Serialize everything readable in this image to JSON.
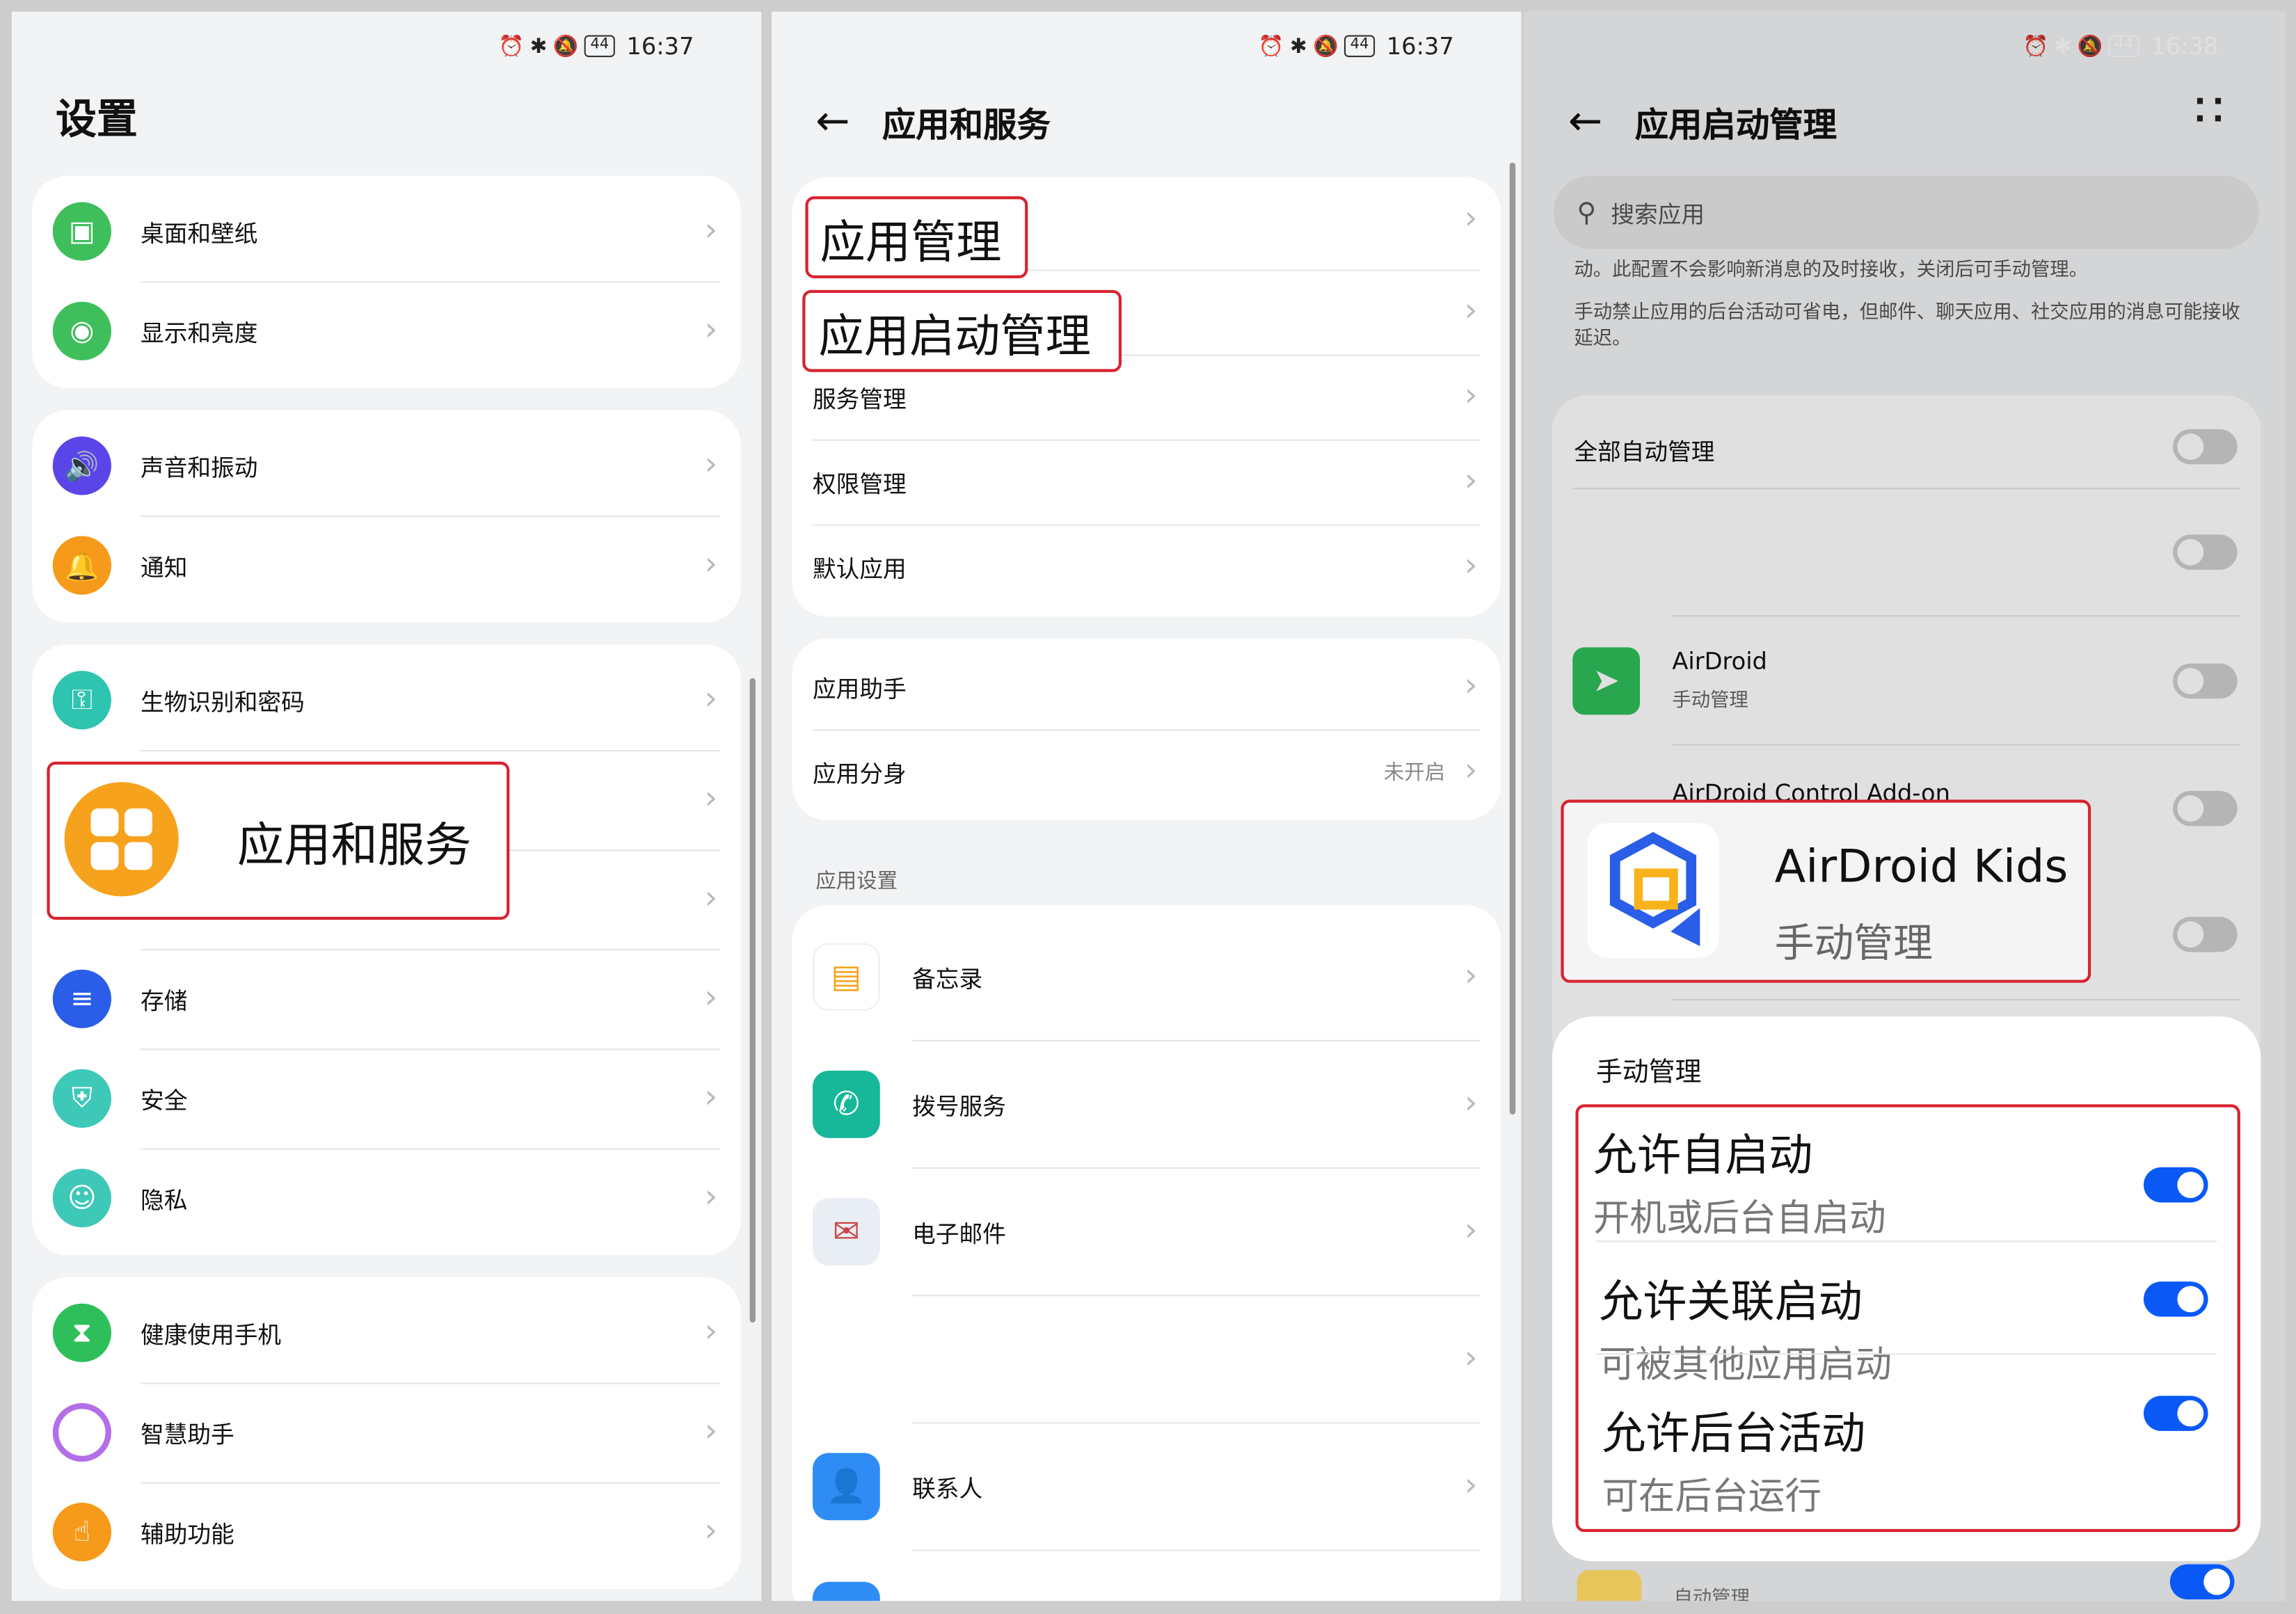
{
  "status_bar": {
    "p1_time": "16:37",
    "p2_time": "16:37",
    "p3_time": "16:38",
    "battery": "44"
  },
  "panel1": {
    "title": "设置",
    "groups": [
      [
        {
          "label": "桌面和壁纸",
          "icon": "picture-icon",
          "color": "#3fbf5c"
        },
        {
          "label": "显示和亮度",
          "icon": "eye-icon",
          "color": "#3fbf5c"
        }
      ],
      [
        {
          "label": "声音和振动",
          "icon": "speaker-icon",
          "color": "#5a46e8"
        },
        {
          "label": "通知",
          "icon": "bell-icon",
          "color": "#f59a1a"
        }
      ],
      [
        {
          "label": "生物识别和密码",
          "icon": "key-icon",
          "color": "#2ec4b0"
        },
        {
          "label": "",
          "icon": "",
          "color": ""
        },
        {
          "label": "",
          "icon": "",
          "color": ""
        },
        {
          "label": "存储",
          "icon": "storage-icon",
          "color": "#2a5de8"
        },
        {
          "label": "安全",
          "icon": "shield-icon",
          "color": "#3ec8b8"
        },
        {
          "label": "隐私",
          "icon": "privacy-icon",
          "color": "#3ec8b8"
        }
      ],
      [
        {
          "label": "健康使用手机",
          "icon": "hourglass-icon",
          "color": "#2fbf5a"
        },
        {
          "label": "智慧助手",
          "icon": "ring-icon",
          "color": "#b46ee8"
        },
        {
          "label": "辅助功能",
          "icon": "hand-icon",
          "color": "#f59a1a"
        }
      ]
    ],
    "callout": {
      "label": "应用和服务",
      "icon": "apps-grid-icon",
      "color": "#f7a21c"
    }
  },
  "panel2": {
    "title": "应用和服务",
    "group1": [
      "应用管理",
      "应用启动管理",
      "服务管理",
      "权限管理",
      "默认应用"
    ],
    "group2": [
      {
        "label": "应用助手",
        "value": ""
      },
      {
        "label": "应用分身",
        "value": "未开启"
      }
    ],
    "section": "应用设置",
    "apps": [
      {
        "label": "备忘录",
        "icon": "notes-icon",
        "color": "#f7a21c"
      },
      {
        "label": "拨号服务",
        "icon": "phone-icon",
        "color": "#17b89a"
      },
      {
        "label": "电子邮件",
        "icon": "mail-icon",
        "color": "#e9eef5"
      },
      {
        "label": "",
        "icon": "",
        "color": ""
      },
      {
        "label": "联系人",
        "icon": "contact-icon",
        "color": "#2f8cf5"
      }
    ],
    "callout1": "应用管理",
    "callout2": "应用启动管理"
  },
  "panel3": {
    "title": "应用启动管理",
    "search_placeholder": "搜索应用",
    "desc1": "动。此配置不会影响新消息的及时接收，关闭后可手动管理。",
    "desc2": "手动禁止应用的后台活动可省电，但邮件、聊天应用、社交应用的消息可能接收延迟。",
    "all_label": "全部自动管理",
    "apps": [
      {
        "name": "AirDroid",
        "sub": "手动管理"
      },
      {
        "name": "AirDroid Control Add-on",
        "sub": ""
      }
    ],
    "kids_name": "AirDroid Kids",
    "kids_sub": "手动管理",
    "bottom_sub": "自动管理",
    "sheet": {
      "title": "手动管理",
      "options": [
        {
          "label": "允许自启动",
          "sub": "开机或后台自启动",
          "on": true
        },
        {
          "label": "允许关联启动",
          "sub": "可被其他应用启动",
          "on": true
        },
        {
          "label": "允许后台活动",
          "sub": "可在后台运行",
          "on": true
        }
      ]
    }
  }
}
